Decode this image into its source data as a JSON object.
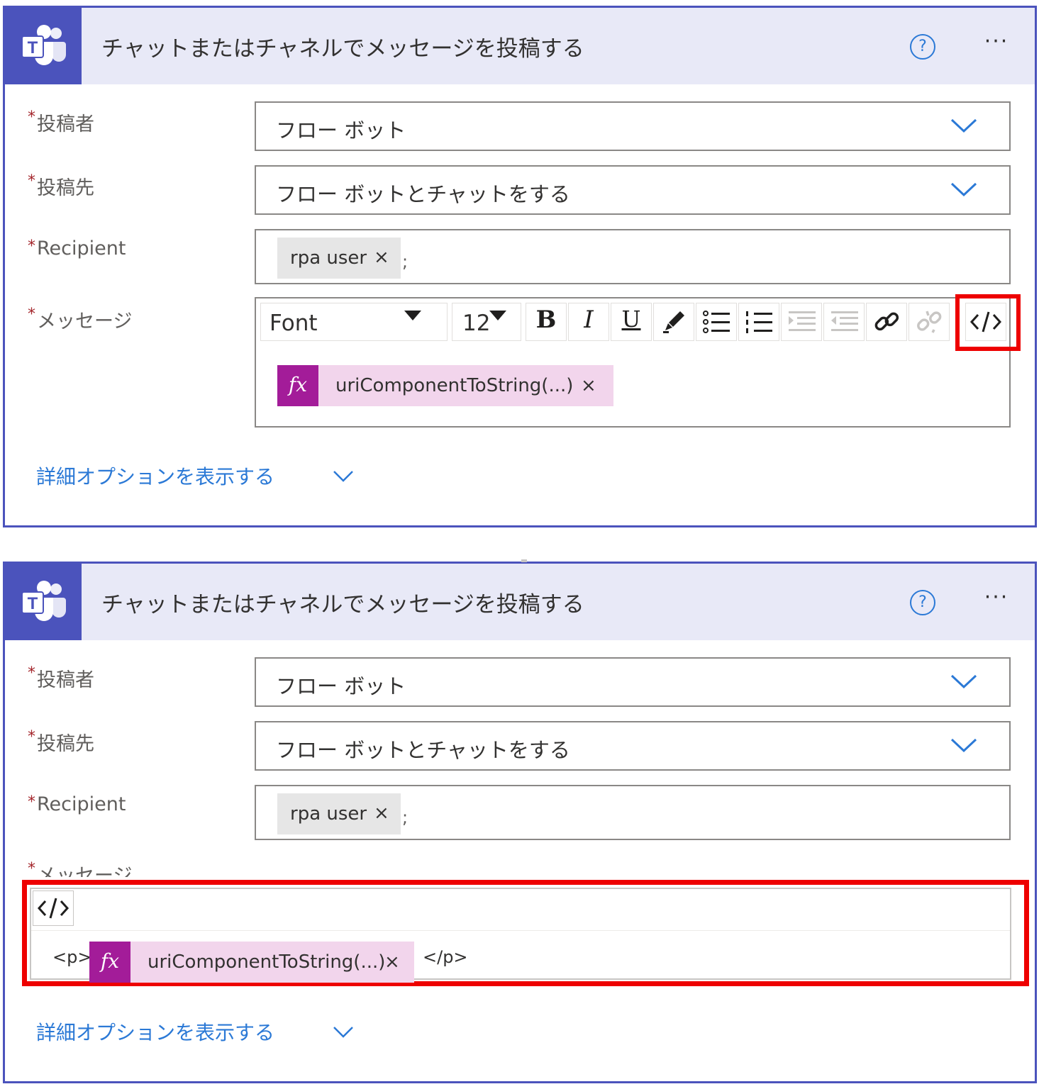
{
  "title": "チャットまたはチャネルでメッセージを投稿する",
  "help": "?",
  "more": "···",
  "fields": {
    "poster": {
      "label": "投稿者",
      "value": "フロー ボット"
    },
    "target": {
      "label": "投稿先",
      "value": "フロー ボットとチャットをする"
    },
    "recipient": {
      "label": "Recipient",
      "token": "rpa user",
      "remove": "×",
      "separator": ";"
    },
    "message": {
      "label": "メッセージ"
    }
  },
  "required_mark": "*",
  "toolbar": {
    "font": "Font",
    "size": "12",
    "bold": "B",
    "italic": "I",
    "underline": "U"
  },
  "fx": {
    "icon": "fx",
    "expression": "uriComponentToString(...)",
    "remove": "×"
  },
  "code_view": {
    "open_tag": "<p>",
    "close_tag": "</p>"
  },
  "advanced_link": "詳細オプションを表示する",
  "colors": {
    "teams_purple": "#4b53bc",
    "header_bg": "#e8e9f7",
    "link_blue": "#2b79d6",
    "fx_magenta": "#a31c99",
    "fx_token_bg": "#f2d5ec",
    "highlight_red": "#ee0000"
  }
}
